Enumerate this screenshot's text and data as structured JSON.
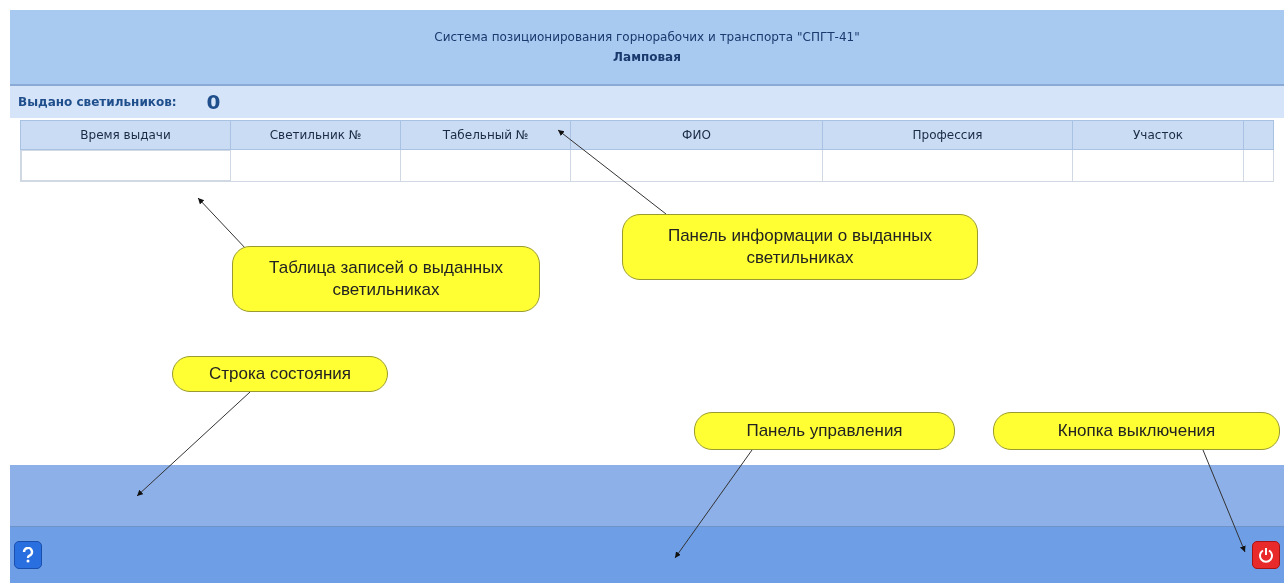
{
  "header": {
    "title": "Система позиционирования горнорабочих и транспорта \"СПГТ-41\"",
    "subtitle": "Ламповая"
  },
  "info_panel": {
    "label": "Выдано светильников:",
    "count": "0"
  },
  "table": {
    "columns": [
      "Время выдачи",
      "Светильник №",
      "Табельный №",
      "ФИО",
      "Профессия",
      "Участок"
    ]
  },
  "callouts": [
    {
      "text": "Таблица записей о выданных светильниках"
    },
    {
      "text": "Панель информации о выданных светильниках"
    },
    {
      "text": "Строка состояния"
    },
    {
      "text": "Панель управления"
    },
    {
      "text": "Кнопка выключения"
    }
  ]
}
